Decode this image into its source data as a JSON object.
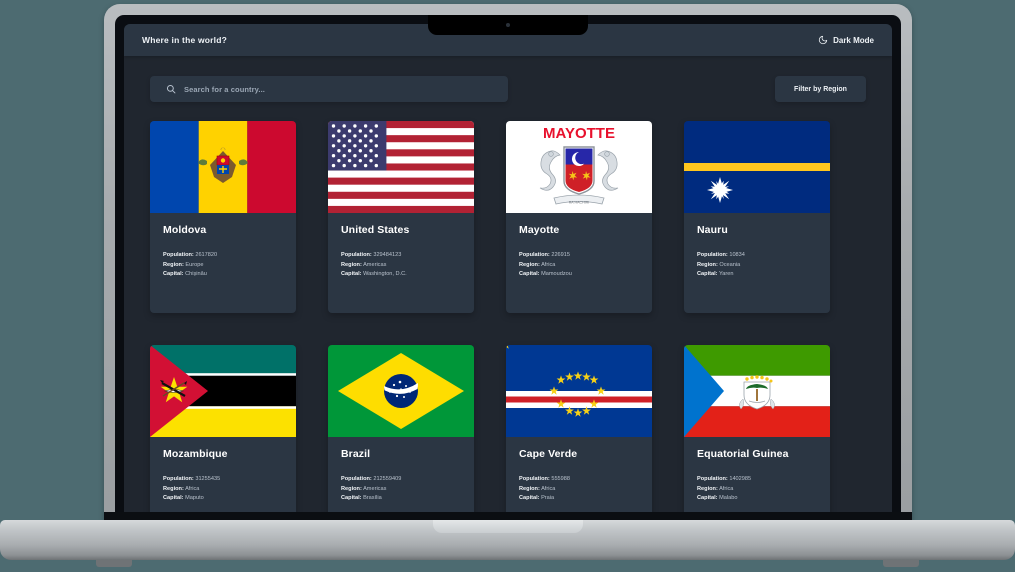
{
  "app": {
    "brand": "Where in the world?",
    "dark_mode_label": "Dark Mode",
    "dark_mode_icon": "moon-icon",
    "bg_color": "#4d6b71",
    "screen_bg": "#20262f",
    "element_bg": "#2b3643",
    "text_color": "#ffffff"
  },
  "search": {
    "icon": "search-icon",
    "placeholder": "Search for a country...",
    "value": ""
  },
  "filter": {
    "label": "Filter by Region"
  },
  "labels": {
    "population": "Population:",
    "region": "Region:",
    "capital": "Capital:"
  },
  "countries": [
    {
      "name": "Moldova",
      "population": "2617820",
      "region": "Europe",
      "capital": "Chișinău",
      "flag": "moldova-flag"
    },
    {
      "name": "United States",
      "population": "329484123",
      "region": "Americas",
      "capital": "Washington, D.C.",
      "flag": "united-states-flag"
    },
    {
      "name": "Mayotte",
      "population": "226915",
      "region": "Africa",
      "capital": "Mamoudzou",
      "flag": "mayotte-flag"
    },
    {
      "name": "Nauru",
      "population": "10834",
      "region": "Oceania",
      "capital": "Yaren",
      "flag": "nauru-flag"
    },
    {
      "name": "Mozambique",
      "population": "31255435",
      "region": "Africa",
      "capital": "Maputo",
      "flag": "mozambique-flag"
    },
    {
      "name": "Brazil",
      "population": "212559409",
      "region": "Americas",
      "capital": "Brasília",
      "flag": "brazil-flag"
    },
    {
      "name": "Cape Verde",
      "population": "555988",
      "region": "Africa",
      "capital": "Praia",
      "flag": "cape-verde-flag"
    },
    {
      "name": "Equatorial Guinea",
      "population": "1402985",
      "region": "Africa",
      "capital": "Malabo",
      "flag": "equatorial-guinea-flag"
    }
  ]
}
